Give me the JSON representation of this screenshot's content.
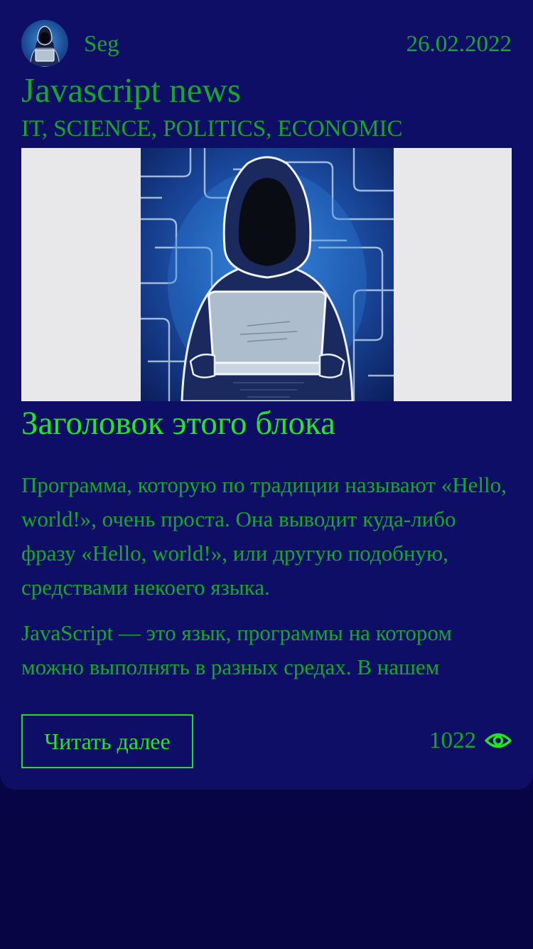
{
  "post": {
    "author": "Seg",
    "date": "26.02.2022",
    "title": "Javascript news",
    "tags": "IT, SCIENCE, POLITICS, ECONOMIC",
    "block_title": "Заголовок этого блока",
    "paragraphs": [
      "Программа, которую по традиции называют «Hello, world!», очень проста. Она выводит куда-либо фразу «Hello, world!», или другую подобную, средствами некоего языка.",
      "JavaScript — это язык, программы на котором можно выполнять в разных средах. В нашем"
    ],
    "read_more_label": "Читать далее",
    "views": "1022"
  },
  "icons": {
    "avatar": "hacker-avatar-icon",
    "views": "eye-icon"
  },
  "colors": {
    "background": "#080544",
    "card": "#0e0e66",
    "text_green": "#15a828",
    "accent_green": "#22e620",
    "image_frame": "#e8e8ea"
  }
}
